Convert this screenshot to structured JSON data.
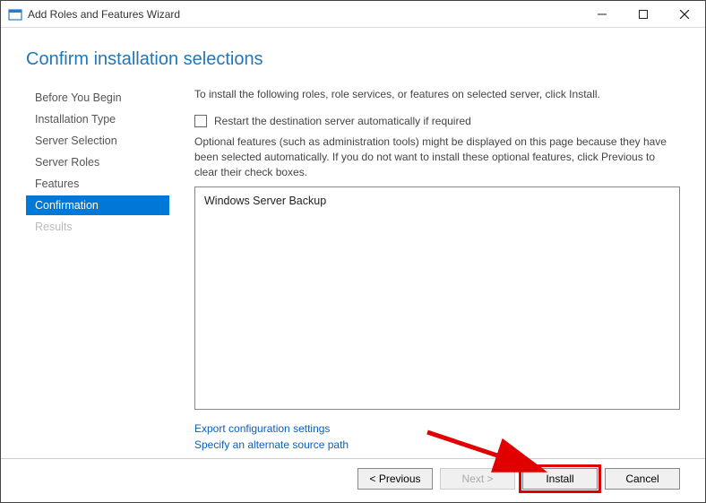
{
  "titlebar": {
    "title": "Add Roles and Features Wizard"
  },
  "header": {
    "page_title": "Confirm installation selections"
  },
  "sidebar": {
    "items": [
      {
        "label": "Before You Begin",
        "state": "normal"
      },
      {
        "label": "Installation Type",
        "state": "normal"
      },
      {
        "label": "Server Selection",
        "state": "normal"
      },
      {
        "label": "Server Roles",
        "state": "normal"
      },
      {
        "label": "Features",
        "state": "normal"
      },
      {
        "label": "Confirmation",
        "state": "active"
      },
      {
        "label": "Results",
        "state": "disabled"
      }
    ]
  },
  "main": {
    "intro": "To install the following roles, role services, or features on selected server, click Install.",
    "restart_checkbox_label": "Restart the destination server automatically if required",
    "restart_checked": false,
    "note": "Optional features (such as administration tools) might be displayed on this page because they have been selected automatically. If you do not want to install these optional features, click Previous to clear their check boxes.",
    "selected_features": [
      "Windows Server Backup"
    ],
    "links": {
      "export": "Export configuration settings",
      "alt_source": "Specify an alternate source path"
    }
  },
  "footer": {
    "previous": "< Previous",
    "next": "Next >",
    "install": "Install",
    "cancel": "Cancel"
  }
}
